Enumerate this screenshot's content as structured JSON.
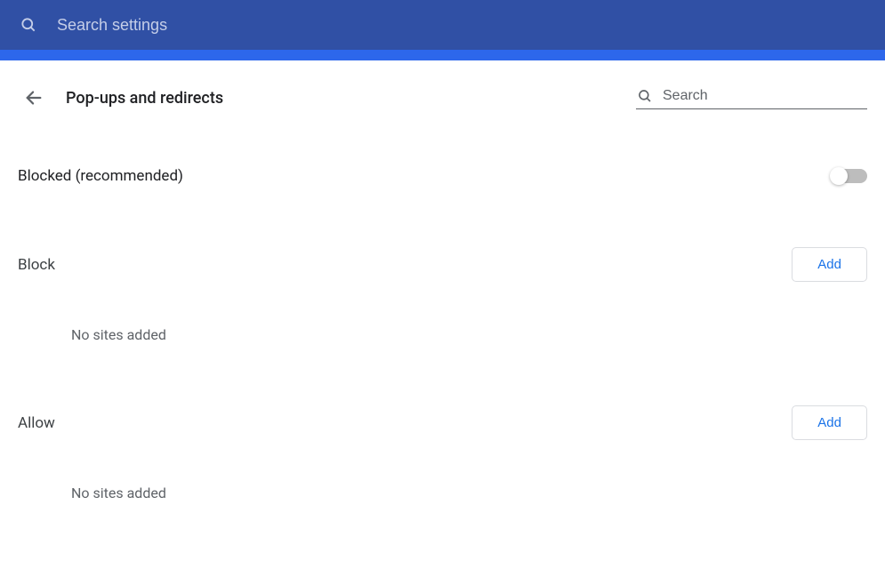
{
  "topbar": {
    "search_placeholder": "Search settings"
  },
  "header": {
    "title": "Pop-ups and redirects",
    "search_placeholder": "Search"
  },
  "main_toggle": {
    "label": "Blocked (recommended)",
    "on": false
  },
  "sections": {
    "block": {
      "title": "Block",
      "add_label": "Add",
      "empty_text": "No sites added"
    },
    "allow": {
      "title": "Allow",
      "add_label": "Add",
      "empty_text": "No sites added"
    }
  }
}
